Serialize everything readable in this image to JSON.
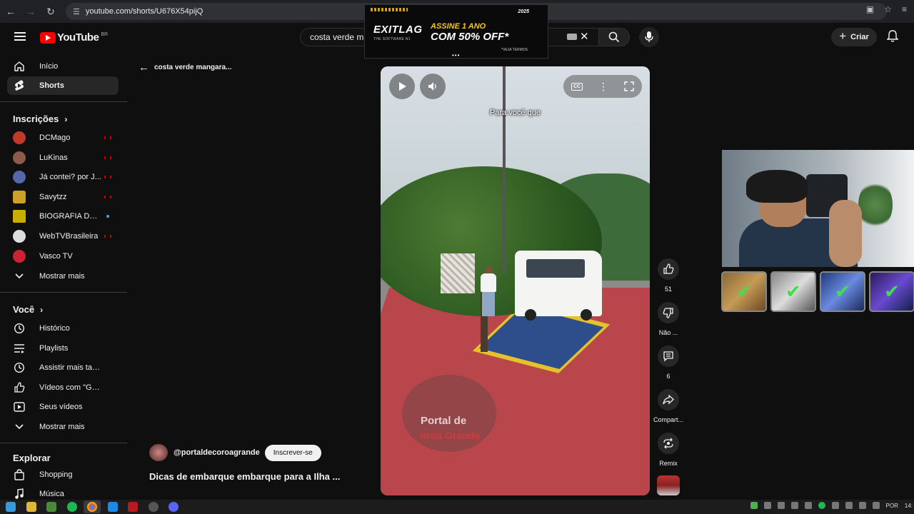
{
  "browser": {
    "url": "youtube.com/shorts/U676X54pijQ"
  },
  "ad": {
    "logo": "EXITLAG",
    "logo_sub": "THE SOFTWARE N1",
    "headline1": "ASSINE 1 ANO",
    "headline2": "COM 50% OFF*",
    "terms": "*VEJA TERMOS",
    "badge": "2025"
  },
  "masthead": {
    "logo_text": "YouTube",
    "country": "BR",
    "search_value": "costa verde m",
    "create_label": "Criar"
  },
  "sidebar": {
    "main": [
      {
        "label": "Início",
        "icon": "home-icon"
      },
      {
        "label": "Shorts",
        "icon": "shorts-icon",
        "active": true
      }
    ],
    "subscriptions_title": "Inscrições",
    "subscriptions": [
      {
        "label": "DCMago",
        "status": "live",
        "color": "#c0392b"
      },
      {
        "label": "LuKinas",
        "status": "live",
        "color": "#8e5b4a"
      },
      {
        "label": "Já contei? por J...",
        "status": "live",
        "color": "#5566aa"
      },
      {
        "label": "Savytzz",
        "status": "live",
        "color": "#c9a227"
      },
      {
        "label": "BIOGRAFIA DO C...",
        "status": "new",
        "color": "#c9b000"
      },
      {
        "label": "WebTVBrasileira",
        "status": "live",
        "color": "#dddddd"
      },
      {
        "label": "Vasco TV",
        "status": "",
        "color": "#cc2233"
      }
    ],
    "show_more_1": "Mostrar mais",
    "you_title": "Você",
    "you": [
      {
        "label": "Histórico",
        "icon": "history-icon"
      },
      {
        "label": "Playlists",
        "icon": "playlists-icon"
      },
      {
        "label": "Assistir mais tarde",
        "icon": "watch-later-icon"
      },
      {
        "label": "Vídeos com \"Gostei\"",
        "icon": "liked-icon"
      },
      {
        "label": "Seus vídeos",
        "icon": "your-videos-icon"
      }
    ],
    "show_more_2": "Mostrar mais",
    "explore_title": "Explorar",
    "explore": [
      {
        "label": "Shopping",
        "icon": "shopping-icon"
      },
      {
        "label": "Música",
        "icon": "music-icon"
      }
    ]
  },
  "main": {
    "back_label": "costa verde mangara...",
    "subtitle": "Para você que",
    "watermark_line1": "Portal de",
    "watermark_line2": "oroa Grande"
  },
  "actions": {
    "likes": "51",
    "dislike": "Não ...",
    "comments": "6",
    "share": "Compart...",
    "remix": "Remix"
  },
  "channel": {
    "handle": "@portaldecoroagrande",
    "subscribe_label": "Inscrever-se",
    "video_title": "Dicas de embarque embarque para a Ilha ..."
  },
  "taskbar": {
    "lang": "POR",
    "time": "14:"
  }
}
